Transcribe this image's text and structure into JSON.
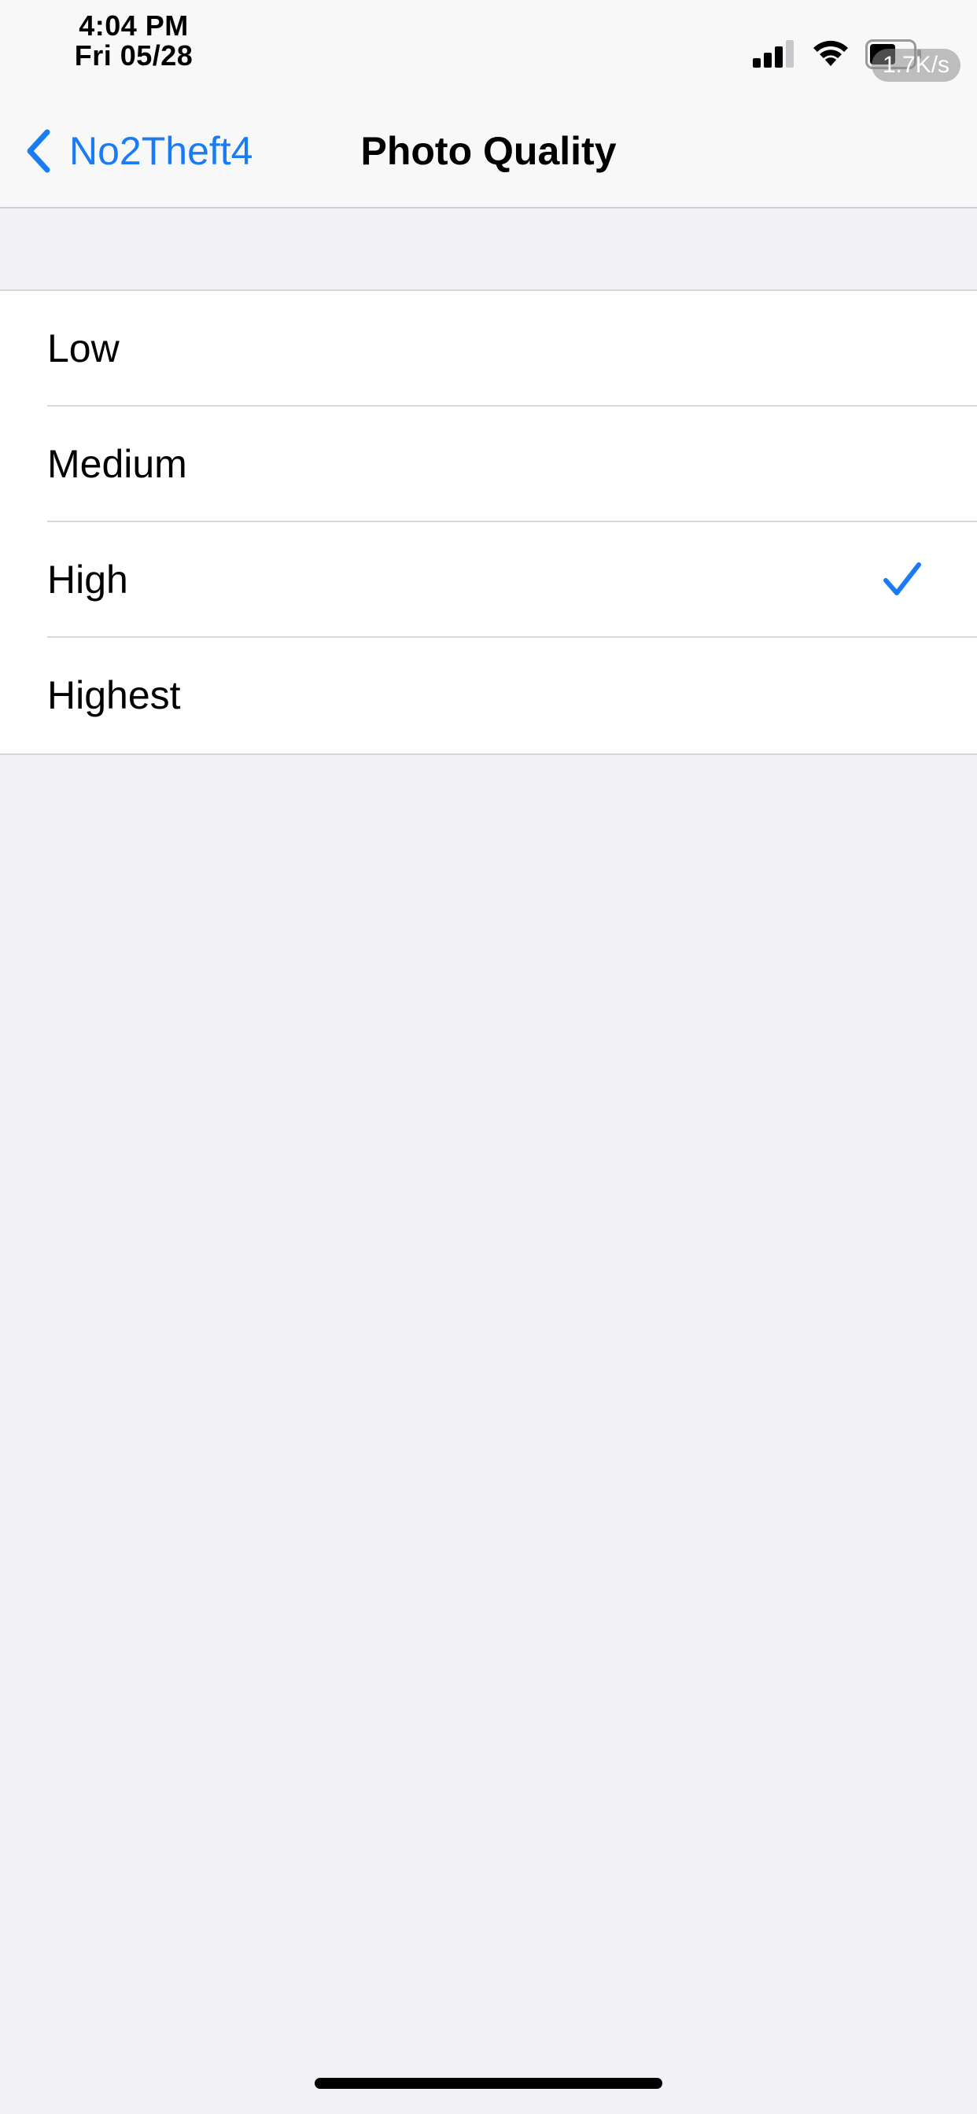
{
  "status_bar": {
    "time": "4:04 PM",
    "date": "Fri 05/28",
    "signal_icon": "cellular-signal-icon",
    "wifi_icon": "wifi-icon",
    "battery_icon": "battery-icon",
    "net_speed": "1.7K/s"
  },
  "nav": {
    "back_label": "No2Theft4",
    "back_icon": "chevron-left-icon",
    "title": "Photo Quality"
  },
  "options": [
    {
      "label": "Low",
      "selected": false
    },
    {
      "label": "Medium",
      "selected": false
    },
    {
      "label": "High",
      "selected": true
    },
    {
      "label": "Highest",
      "selected": false
    }
  ],
  "colors": {
    "accent": "#1a7cf4",
    "background": "#f1f1f6",
    "cell_background": "#ffffff"
  }
}
